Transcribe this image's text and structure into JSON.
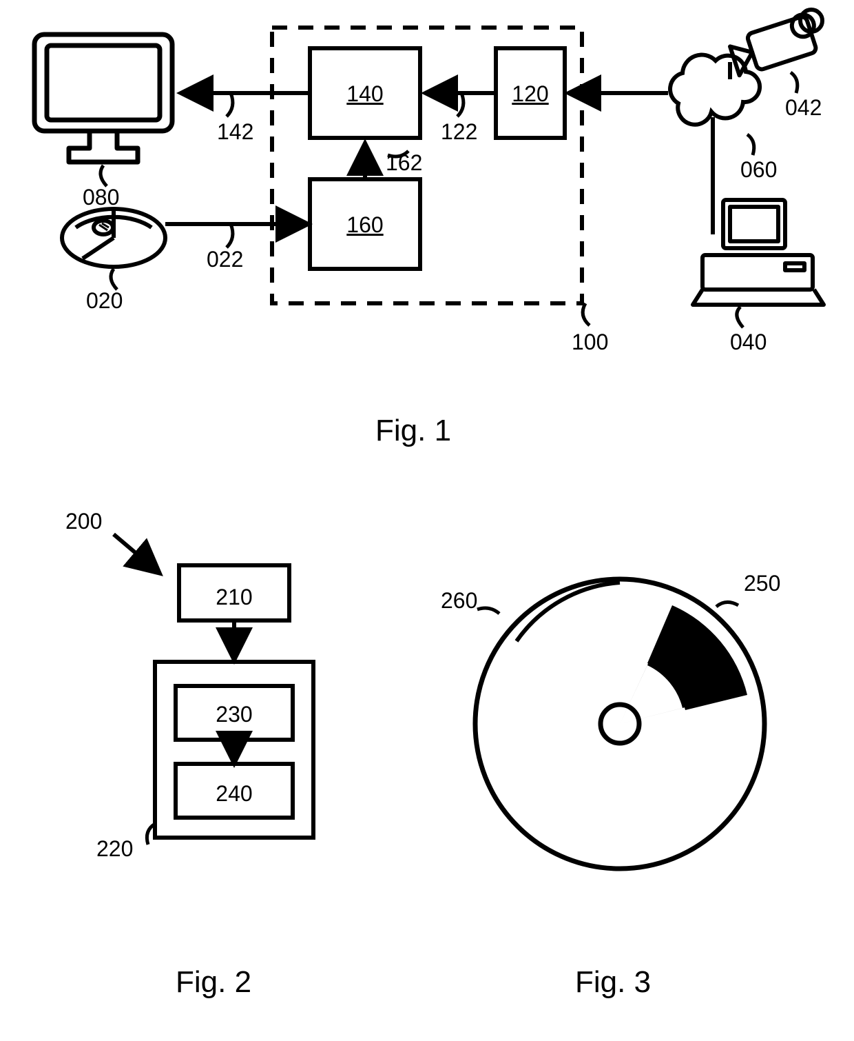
{
  "fig1": {
    "caption": "Fig. 1",
    "labels": {
      "l080": "080",
      "l142": "142",
      "l140": "140",
      "l122": "122",
      "l120": "120",
      "l162": "162",
      "l160": "160",
      "l022": "022",
      "l020": "020",
      "l100": "100",
      "l042": "042",
      "l060": "060",
      "l040": "040"
    }
  },
  "fig2": {
    "caption": "Fig. 2",
    "labels": {
      "l200": "200",
      "l210": "210",
      "l220": "220",
      "l230": "230",
      "l240": "240"
    }
  },
  "fig3": {
    "caption": "Fig. 3",
    "labels": {
      "l260": "260",
      "l250": "250"
    }
  }
}
